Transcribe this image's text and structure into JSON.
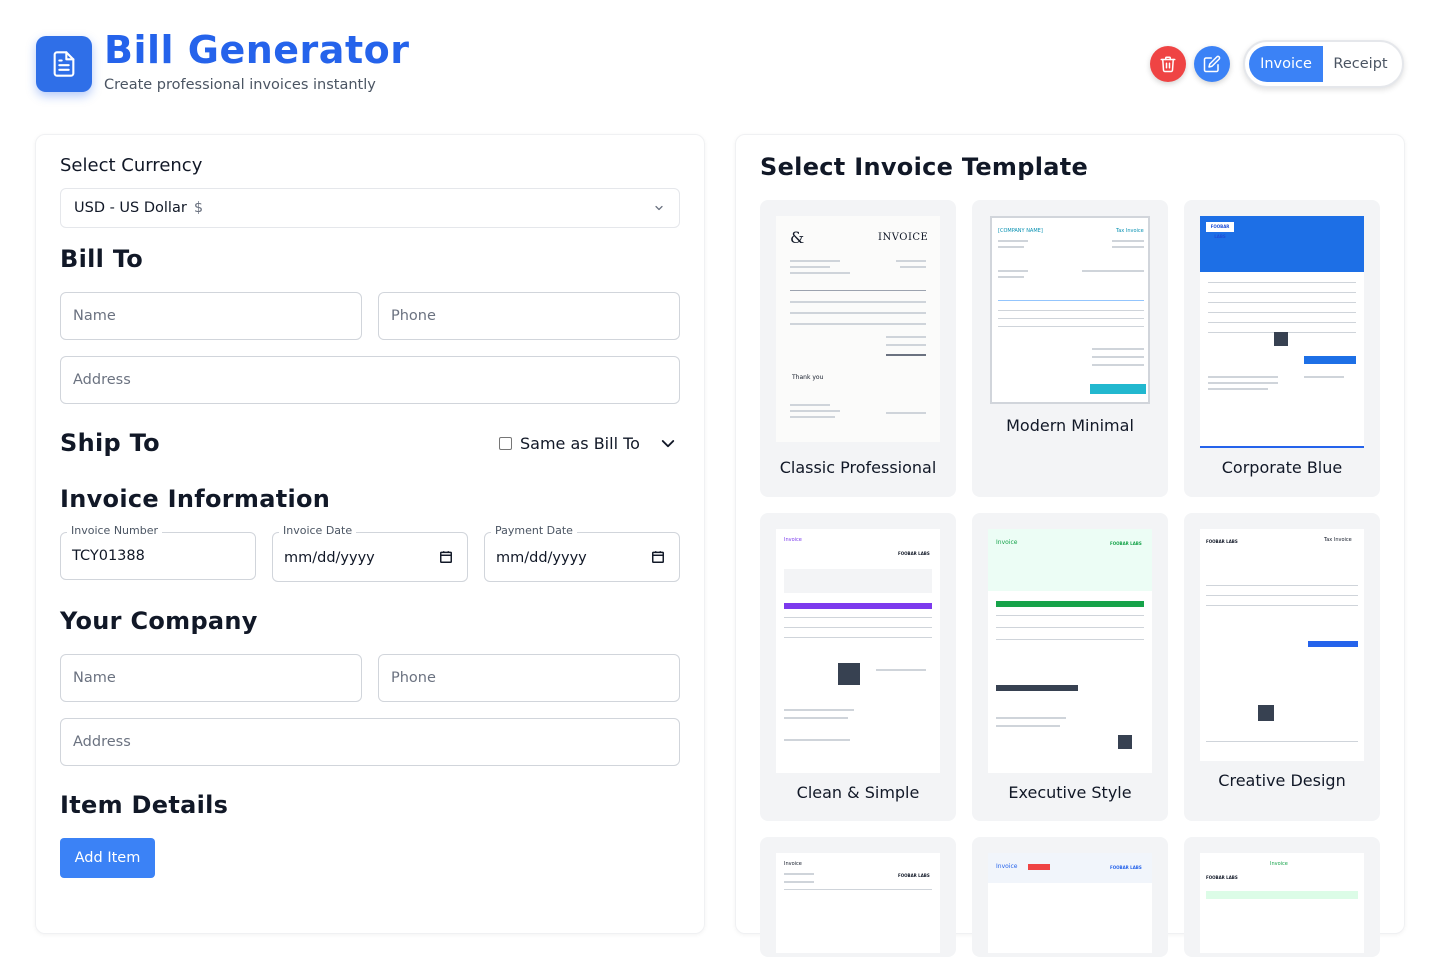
{
  "app": {
    "title": "Bill Generator",
    "subtitle": "Create professional invoices instantly"
  },
  "header": {
    "delete_icon": "trash-icon",
    "edit_icon": "edit-icon",
    "mode_toggle": {
      "selected": "Invoice",
      "options": [
        "Invoice",
        "Receipt"
      ]
    },
    "accent_color": "#2563eb",
    "delete_color": "#ef4444"
  },
  "form": {
    "currency": {
      "label": "Select Currency",
      "value": "USD - US Dollar",
      "symbol": "$"
    },
    "bill_to": {
      "title": "Bill To",
      "name_placeholder": "Name",
      "phone_placeholder": "Phone",
      "address_placeholder": "Address"
    },
    "ship_to": {
      "title": "Ship To",
      "same_as_label": "Same as Bill To",
      "same_as_checked": false
    },
    "invoice_info": {
      "title": "Invoice Information",
      "invoice_number_label": "Invoice Number",
      "invoice_number_value": "TCY01388",
      "invoice_date_label": "Invoice Date",
      "invoice_date_value": "mm/dd/yyyy",
      "payment_date_label": "Payment Date",
      "payment_date_value": "mm/dd/yyyy"
    },
    "your_company": {
      "title": "Your Company",
      "name_placeholder": "Name",
      "phone_placeholder": "Phone",
      "address_placeholder": "Address"
    },
    "items": {
      "title": "Item Details",
      "add_label": "Add Item"
    }
  },
  "templates": {
    "title": "Select Invoice Template",
    "items": [
      {
        "name": "Classic Professional",
        "thumb_heading": "INVOICE",
        "thumb_footer": "Thank you"
      },
      {
        "name": "Modern Minimal",
        "thumb_heading": "Tax Invoice",
        "thumb_company": "[COMPANY NAME]"
      },
      {
        "name": "Corporate Blue",
        "thumb_logo": "FOOBAR LABS"
      },
      {
        "name": "Clean & Simple",
        "thumb_heading": "Invoice",
        "thumb_logo": "FOOBAR LABS"
      },
      {
        "name": "Executive Style",
        "thumb_heading": "Invoice",
        "thumb_logo": "FOOBAR LABS"
      },
      {
        "name": "Creative Design",
        "thumb_heading": "Tax Invoice",
        "thumb_logo": "FOOBAR LABS"
      },
      {
        "thumb_heading": "Invoice",
        "thumb_logo": "FOOBAR LABS"
      },
      {
        "thumb_heading": "Invoice",
        "thumb_logo": "FOOBAR LABS"
      },
      {
        "thumb_heading": "Invoice",
        "thumb_logo": "FOOBAR LABS"
      }
    ]
  }
}
